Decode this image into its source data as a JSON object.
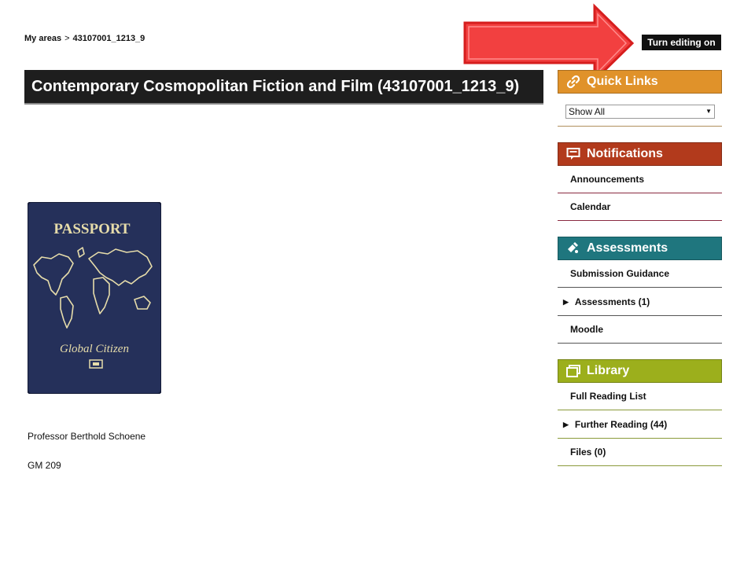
{
  "breadcrumb": {
    "root": "My areas",
    "separator": ">",
    "current": "43107001_1213_9"
  },
  "toolbar": {
    "turn_editing_label": "Turn editing on"
  },
  "course": {
    "title": "Contemporary Cosmopolitan Fiction and Film (43107001_1213_9)",
    "image": {
      "heading": "PASSPORT",
      "caption": "Global Citizen"
    },
    "professor": "Professor Berthold Schoene",
    "room": "GM 209"
  },
  "sidebar": {
    "quick_links": {
      "title": "Quick Links",
      "select_value": "Show All",
      "color": "#e0922a"
    },
    "notifications": {
      "title": "Notifications",
      "color": "#b23a1c",
      "items": [
        "Announcements",
        "Calendar"
      ]
    },
    "assessments": {
      "title": "Assessments",
      "color": "#1f767e",
      "items": [
        "Submission Guidance",
        "Assessments (1)",
        "Moodle"
      ]
    },
    "library": {
      "title": "Library",
      "color": "#9caf1c",
      "items": [
        "Full Reading List",
        "Further Reading (44)",
        "Files (0)"
      ]
    }
  },
  "annotation": {
    "arrow_color": "#f24040"
  }
}
